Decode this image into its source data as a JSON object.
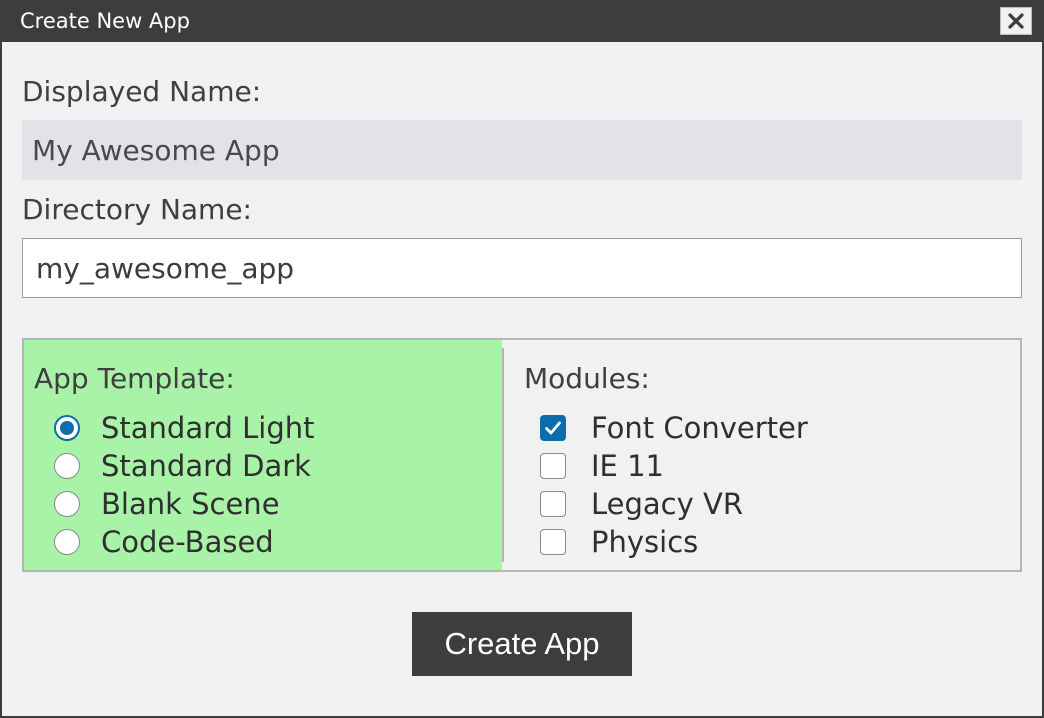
{
  "window": {
    "title": "Create New App"
  },
  "form": {
    "displayed_name_label": "Displayed Name:",
    "displayed_name_value": "My Awesome App",
    "directory_name_label": "Directory Name:",
    "directory_name_value": "my_awesome_app"
  },
  "template": {
    "title": "App Template:",
    "options": [
      {
        "label": "Standard Light",
        "selected": true
      },
      {
        "label": "Standard Dark",
        "selected": false
      },
      {
        "label": "Blank Scene",
        "selected": false
      },
      {
        "label": "Code-Based",
        "selected": false
      }
    ]
  },
  "modules": {
    "title": "Modules:",
    "items": [
      {
        "label": "Font Converter",
        "checked": true
      },
      {
        "label": "IE 11",
        "checked": false
      },
      {
        "label": "Legacy VR",
        "checked": false
      },
      {
        "label": "Physics",
        "checked": false
      }
    ]
  },
  "actions": {
    "create_label": "Create App"
  },
  "colors": {
    "titlebar": "#3d3d3d",
    "template_bg": "#a8f3a8",
    "accent": "#0b6dab"
  },
  "icons": {
    "close": "close-icon",
    "check": "check-icon"
  }
}
